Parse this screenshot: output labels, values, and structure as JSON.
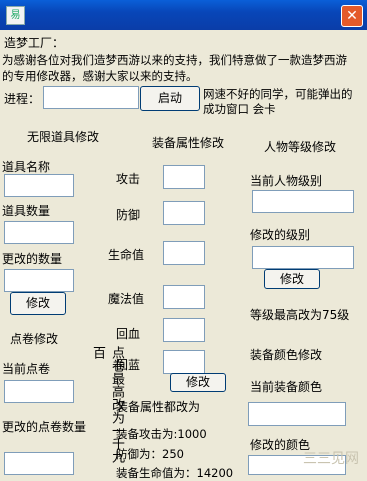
{
  "window": {
    "app_icon_glyph": "易",
    "close_glyph": "✕"
  },
  "intro": {
    "heading": "造梦工厂：",
    "line1": "为感谢各位对我们造梦西游以来的支持，我们特意做了一款造梦西游",
    "line2": "的专用修改器，感谢大家以来的支持。"
  },
  "progress": {
    "label": "进程：",
    "value": "",
    "start_button": "启动",
    "note_line1": "网速不好的同学，可能弹出的",
    "note_line2": "成功窗口  会卡"
  },
  "item_section": {
    "title": "无限道具修改",
    "name_label": "道具名称",
    "name_value": "",
    "count_label": "道具数量",
    "count_value": "",
    "changed_count_label": "更改的数量",
    "changed_count_value": "",
    "modify_button": "修改"
  },
  "points_section": {
    "title": "点卷修改",
    "current_label": "当前点卷",
    "current_value": "",
    "changed_label": "更改的点卷数量",
    "changed_value": "",
    "vertical_note": "点卷最高改为一千九百"
  },
  "equip_section": {
    "title": "装备属性修改",
    "attack_label": "攻击",
    "defense_label": "防御",
    "hp_label": "生命值",
    "mp_label": "魔法值",
    "hp_regen_label": "回血",
    "mp_regen_label": "回蓝",
    "modify_button": "修改",
    "note": "装备属性都改为",
    "attack_note": "装备攻击为:1000",
    "defense_note": "防御为：250",
    "hp_note": "装备生命值为：14200"
  },
  "level_section": {
    "title": "人物等级修改",
    "current_label": "当前人物级别",
    "changed_label": "修改的级别",
    "modify_button": "修改",
    "note": "等级最高改为75级"
  },
  "color_section": {
    "title": "装备颜色修改",
    "current_label": "当前装备颜色",
    "changed_label": "修改的颜色"
  },
  "watermark": "三三见网"
}
